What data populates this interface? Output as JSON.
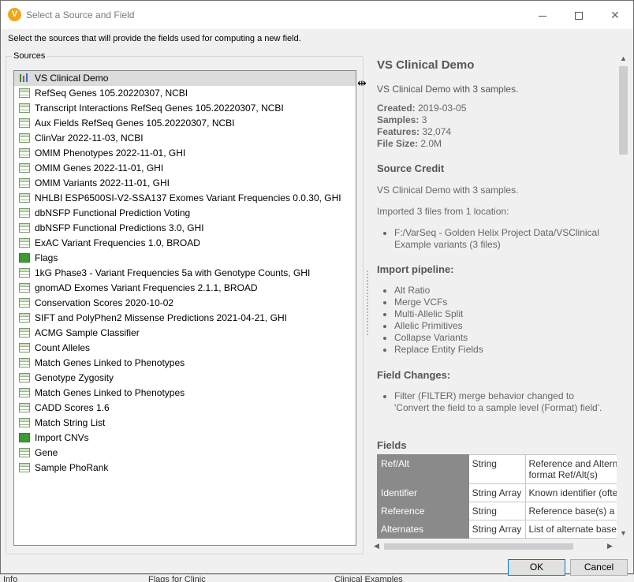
{
  "window": {
    "title": "Select a Source and Field",
    "app_icon_letter": "V",
    "instruction": "Select the sources that will provide the fields used for computing a new field."
  },
  "sources": {
    "legend": "Sources",
    "items": [
      {
        "label": "VS Clinical Demo",
        "icon": "sample-pins-icon",
        "selected": true
      },
      {
        "label": "RefSeq Genes 105.20220307, NCBI",
        "icon": "table-icon"
      },
      {
        "label": "Transcript Interactions RefSeq Genes 105.20220307, NCBI",
        "icon": "table-icon"
      },
      {
        "label": "Aux Fields RefSeq Genes 105.20220307, NCBI",
        "icon": "table-icon"
      },
      {
        "label": "ClinVar 2022-11-03, NCBI",
        "icon": "table-icon"
      },
      {
        "label": "OMIM Phenotypes 2022-11-01, GHI",
        "icon": "table-icon"
      },
      {
        "label": "OMIM Genes 2022-11-01, GHI",
        "icon": "table-icon"
      },
      {
        "label": "OMIM Variants 2022-11-01, GHI",
        "icon": "table-icon"
      },
      {
        "label": "NHLBI ESP6500SI-V2-SSA137 Exomes Variant Frequencies 0.0.30, GHI",
        "icon": "table-icon"
      },
      {
        "label": "dbNSFP Functional Prediction Voting",
        "icon": "table-icon"
      },
      {
        "label": "dbNSFP Functional Predictions 3.0, GHI",
        "icon": "table-icon"
      },
      {
        "label": "ExAC Variant Frequencies 1.0, BROAD",
        "icon": "table-icon"
      },
      {
        "label": "Flags",
        "icon": "flag-table-icon"
      },
      {
        "label": "1kG Phase3 - Variant Frequencies 5a with Genotype Counts, GHI",
        "icon": "table-icon"
      },
      {
        "label": "gnomAD Exomes Variant Frequencies 2.1.1, BROAD",
        "icon": "table-icon"
      },
      {
        "label": "Conservation Scores 2020-10-02",
        "icon": "table-icon"
      },
      {
        "label": "SIFT and PolyPhen2 Missense Predictions 2021-04-21, GHI",
        "icon": "table-icon"
      },
      {
        "label": "ACMG Sample Classifier",
        "icon": "table-icon"
      },
      {
        "label": "Count Alleles",
        "icon": "table-icon"
      },
      {
        "label": "Match Genes Linked to Phenotypes",
        "icon": "table-icon"
      },
      {
        "label": "Genotype Zygosity",
        "icon": "table-icon"
      },
      {
        "label": "Match Genes Linked to Phenotypes",
        "icon": "table-icon"
      },
      {
        "label": "CADD Scores 1.6",
        "icon": "table-icon"
      },
      {
        "label": "Match String List",
        "icon": "table-icon"
      },
      {
        "label": "Import CNVs",
        "icon": "flag-table-icon"
      },
      {
        "label": "Gene",
        "icon": "table-icon"
      },
      {
        "label": "Sample PhoRank",
        "icon": "table-icon"
      }
    ]
  },
  "detail": {
    "title": "VS Clinical Demo",
    "summary": "VS Clinical Demo with 3 samples.",
    "created_label": "Created:",
    "created_value": " 2019-03-05",
    "samples_label": "Samples:",
    "samples_value": " 3",
    "features_label": "Features:",
    "features_value": " 32,074",
    "filesize_label": "File Size:",
    "filesize_value": " 2.0M",
    "source_credit_heading": "Source Credit",
    "source_credit_text": "VS Clinical Demo with 3 samples.",
    "imported_text": "Imported 3 files from 1 location:",
    "import_location": "F:/VarSeq - Golden Helix Project Data/VSClinical Example variants (3 files)",
    "pipeline_heading": "Import pipeline:",
    "pipeline_steps": [
      "Alt Ratio",
      "Merge VCFs",
      "Multi-Allelic Split",
      "Allelic Primitives",
      "Collapse Variants",
      "Replace Entity Fields"
    ],
    "field_changes_heading": "Field Changes:",
    "field_change": "Filter (FILTER) merge behavior changed to 'Convert the field to a sample level (Format) field'.",
    "fields_heading": "Fields",
    "fields": [
      {
        "name": "Ref/Alt",
        "type": "String",
        "desc": "Reference and Altern format Ref/Alt(s)"
      },
      {
        "name": "Identifier",
        "type": "String Array",
        "desc": "Known identifier (ofte"
      },
      {
        "name": "Reference",
        "type": "String",
        "desc": "Reference base(s) a"
      },
      {
        "name": "Alternates",
        "type": "String Array",
        "desc": "List of alternate base"
      }
    ]
  },
  "buttons": {
    "ok": "OK",
    "cancel": "Cancel"
  },
  "background": {
    "left": "Info",
    "middle": "Flags for Clinic",
    "right": "Clinical Examples"
  }
}
